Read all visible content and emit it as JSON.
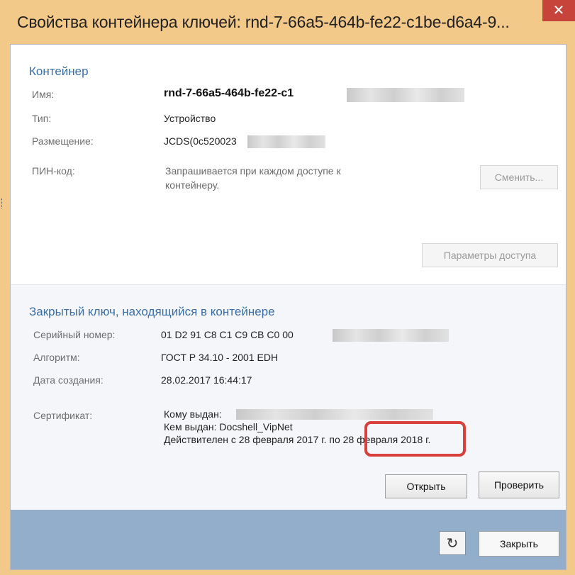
{
  "window": {
    "title": "Свойства контейнера ключей: rnd-7-66a5-464b-fe22-c1be-d6a4-9...",
    "close_label": "✕"
  },
  "container": {
    "section_title": "Контейнер",
    "name_label": "Имя:",
    "name_value": "rnd-7-66a5-464b-fe22-c1",
    "type_label": "Тип:",
    "type_value": "Устройство",
    "location_label": "Размещение:",
    "location_value": "JCDS(0c520023",
    "pin_label": "ПИН-код:",
    "pin_value_line1": "Запрашивается при каждом доступе к",
    "pin_value_line2": "контейнеру.",
    "change_button": "Сменить...",
    "access_button": "Параметры доступа"
  },
  "private_key": {
    "section_title": "Закрытый ключ, находящийся в контейнере",
    "serial_label": "Серийный номер:",
    "serial_value": "01 D2 91 C8 C1 C9 CB C0 00",
    "algorithm_label": "Алгоритм:",
    "algorithm_value": "ГОСТ Р 34.10 - 2001 EDH",
    "created_label": "Дата создания:",
    "created_value": "28.02.2017 16:44:17",
    "cert_label": "Сертификат:",
    "cert_issued_to": "Кому выдан:",
    "cert_issued_by": "Кем выдан: Docshell_VipNet",
    "cert_valid": "Действителен с 28 февраля 2017 г. по 28 февраля 2018 г.",
    "open_button": "Открыть",
    "verify_button": "Проверить"
  },
  "footer": {
    "refresh_icon": "refresh-icon",
    "refresh_glyph": "↻",
    "close_button": "Закрыть"
  }
}
